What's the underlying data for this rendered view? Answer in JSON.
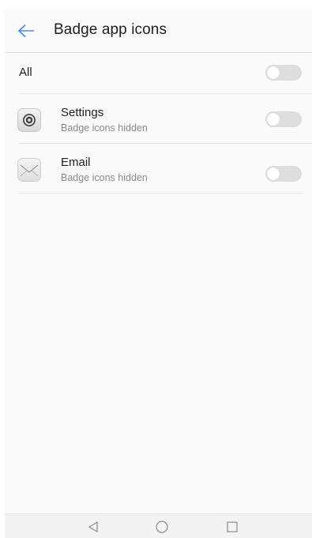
{
  "header": {
    "title": "Badge app icons",
    "back_icon": "arrow-left-icon",
    "accent_color": "#3d8ef0"
  },
  "all_row": {
    "label": "All",
    "toggle_on": false
  },
  "apps": [
    {
      "name": "Settings",
      "status": "Badge icons hidden",
      "icon": "settings-gear-icon",
      "toggle_on": false
    },
    {
      "name": "Email",
      "status": "Badge icons hidden",
      "icon": "email-envelope-icon",
      "toggle_on": false
    }
  ],
  "navbar": {
    "buttons": [
      "back-triangle-icon",
      "home-circle-icon",
      "recents-square-icon"
    ]
  }
}
